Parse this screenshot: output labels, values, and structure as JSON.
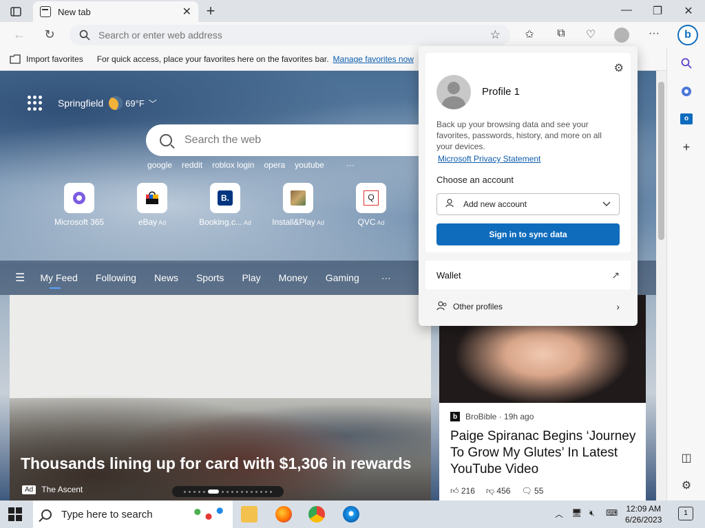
{
  "browser": {
    "tab_title": "New tab",
    "address_placeholder": "Search or enter web address"
  },
  "favorites_bar": {
    "import_label": "Import favorites",
    "hint": "For quick access, place your favorites here on the favorites bar.",
    "manage_link": "Manage favorites now"
  },
  "newtab": {
    "location": "Springfield",
    "temperature": "69°F",
    "search_placeholder": "Search the web",
    "quick_links": [
      "google",
      "reddit",
      "roblox login",
      "opera",
      "youtube"
    ],
    "tiles": [
      {
        "label": "Microsoft 365",
        "ad": ""
      },
      {
        "label": "eBay",
        "ad": "Ad"
      },
      {
        "label": "Booking.c...",
        "ad": "Ad"
      },
      {
        "label": "Install&Play",
        "ad": "Ad"
      },
      {
        "label": "QVC",
        "ad": "Ad"
      }
    ],
    "feed_tabs": [
      "My Feed",
      "Following",
      "News",
      "Sports",
      "Play",
      "Money",
      "Gaming"
    ],
    "main_card": {
      "headline": "Thousands lining up for card with $1,306 in rewards",
      "ad_tag": "Ad",
      "source": "The Ascent"
    },
    "side_card": {
      "source_logo": "b",
      "source": "BroBible · 19h ago",
      "title": "Paige Spiranac Begins ‘Journey To Grow My Glutes’ In Latest YouTube Video",
      "likes": "216",
      "dislikes": "456",
      "comments": "55"
    }
  },
  "profile_flyout": {
    "name": "Profile 1",
    "description": "Back up your browsing data and see your favorites, passwords, history, and more on all your devices.",
    "privacy_link": "Microsoft Privacy Statement",
    "choose_label": "Choose an account",
    "account_select": "Add new account",
    "signin_button": "Sign in to sync data",
    "wallet": "Wallet",
    "other_profiles": "Other profiles"
  },
  "taskbar": {
    "search_placeholder": "Type here to search",
    "time": "12:09 AM",
    "date": "6/26/2023",
    "notification_count": "1"
  },
  "colors": {
    "accent": "#0f6cbd",
    "link": "#0b5cad"
  }
}
